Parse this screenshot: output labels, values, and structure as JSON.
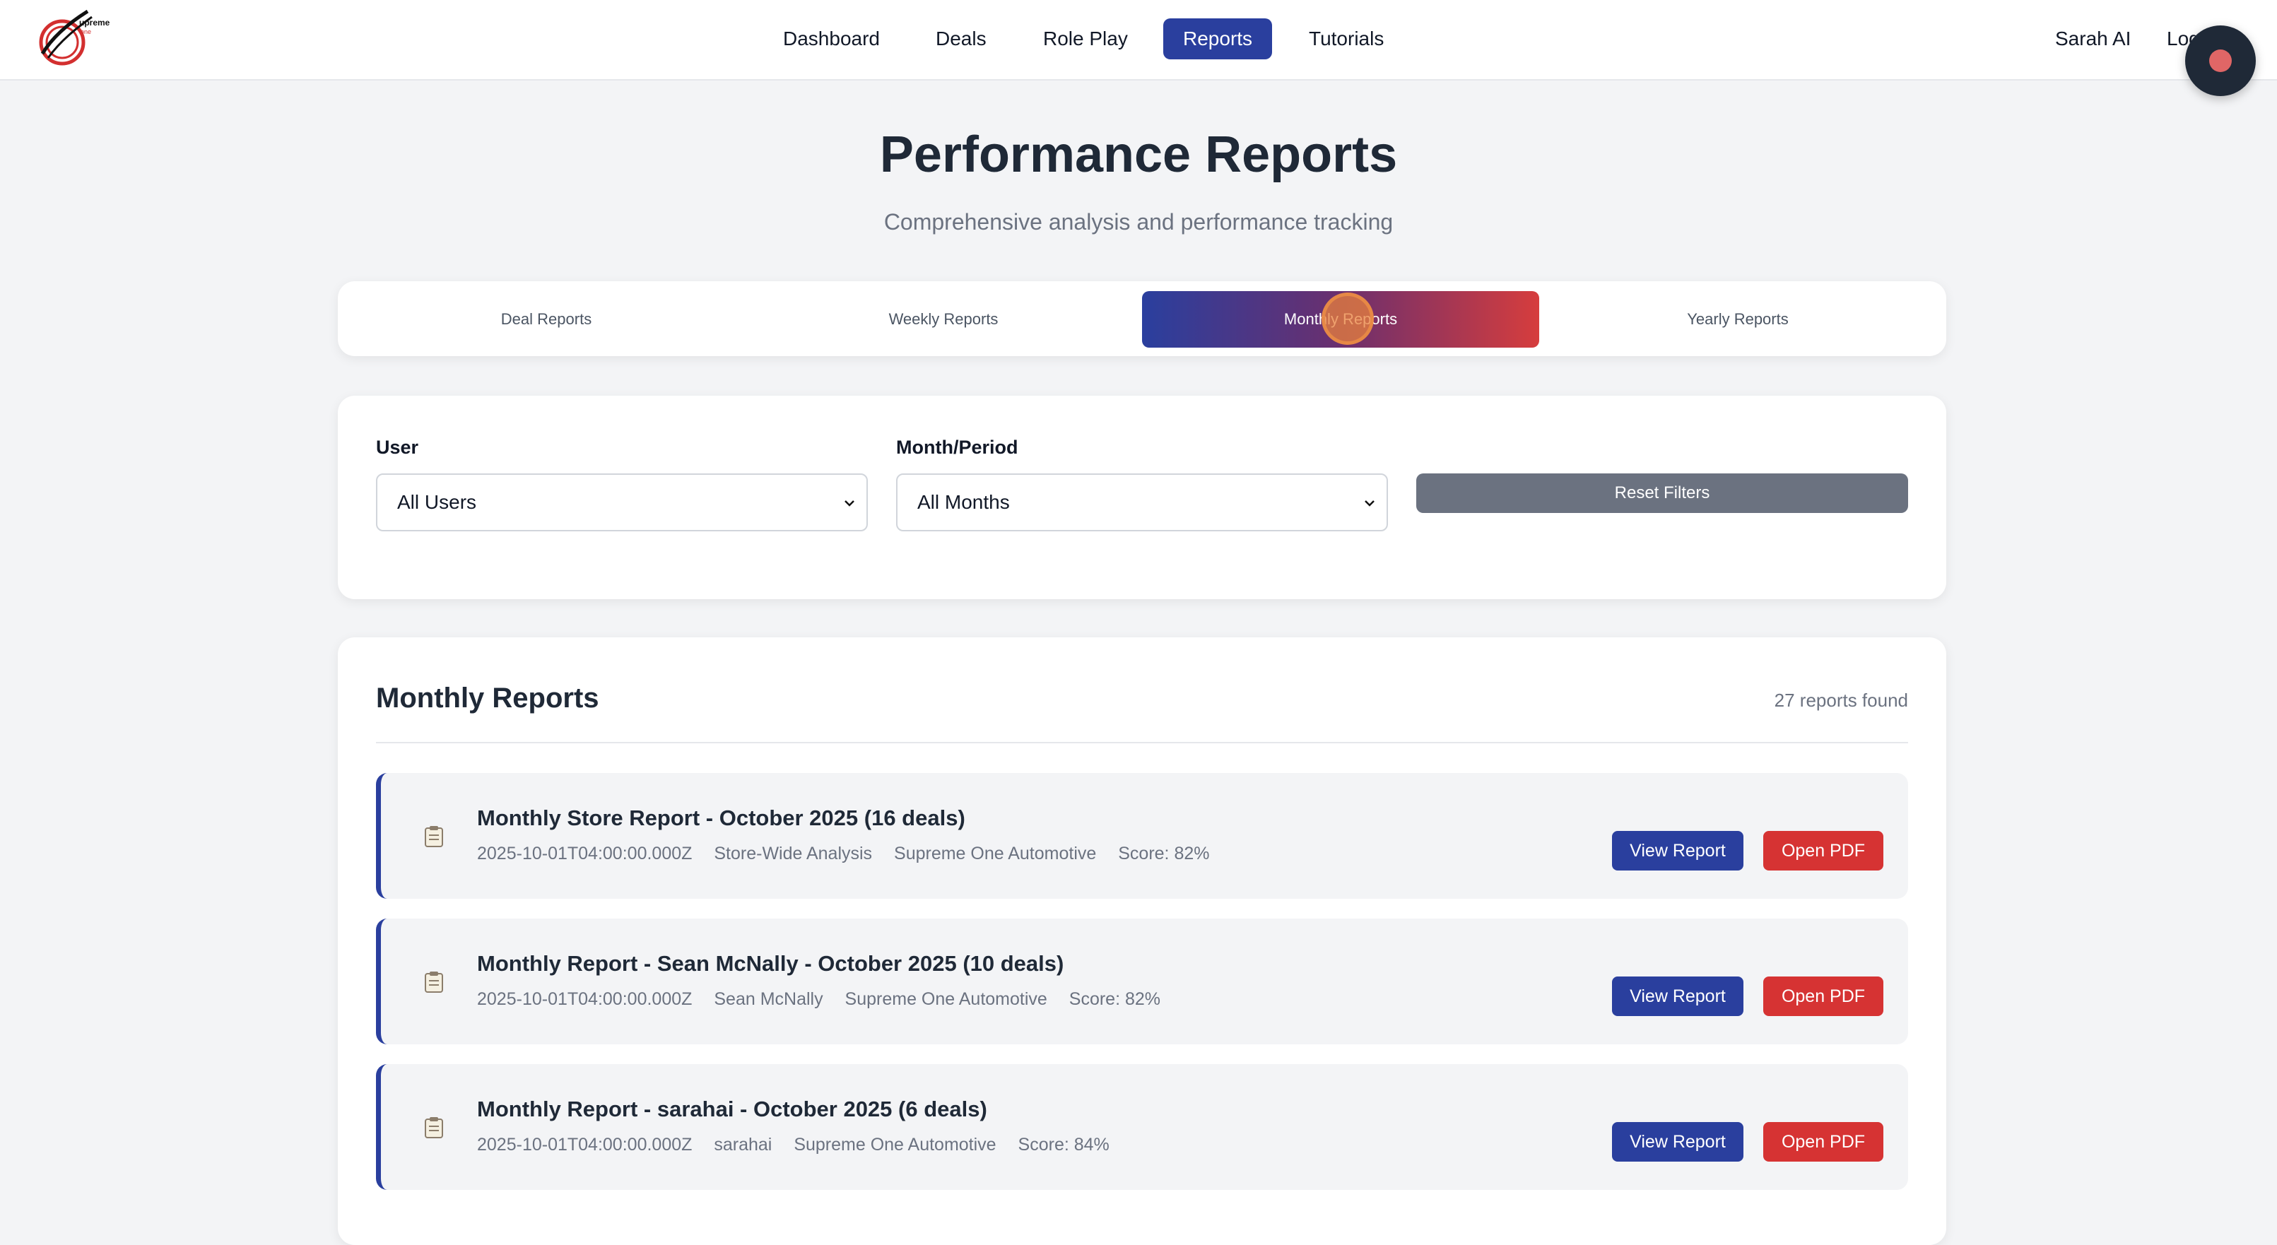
{
  "brand": {
    "logo_text": "Supreme One"
  },
  "nav": {
    "items": [
      "Dashboard",
      "Deals",
      "Role Play",
      "Reports",
      "Tutorials"
    ],
    "active": "Reports",
    "user_name": "Sarah AI",
    "logout_label": "Logout"
  },
  "header": {
    "title": "Performance Reports",
    "subtitle": "Comprehensive analysis and performance tracking"
  },
  "tabs": [
    "Deal Reports",
    "Weekly Reports",
    "Monthly Reports",
    "Yearly Reports"
  ],
  "active_tab": "Monthly Reports",
  "filters": {
    "user_label": "User",
    "user_value": "All Users",
    "period_label": "Month/Period",
    "period_value": "All Months",
    "reset_label": "Reset Filters"
  },
  "reports": {
    "title": "Monthly Reports",
    "count_text": "27 reports found",
    "view_label": "View Report",
    "pdf_label": "Open PDF",
    "items": [
      {
        "title": "Monthly Store Report - October 2025 (16 deals)",
        "date": "2025-10-01T04:00:00.000Z",
        "scope": "Store-Wide Analysis",
        "dealership": "Supreme One Automotive",
        "score": "Score: 82%"
      },
      {
        "title": "Monthly Report - Sean McNally - October 2025 (10 deals)",
        "date": "2025-10-01T04:00:00.000Z",
        "scope": "Sean McNally",
        "dealership": "Supreme One Automotive",
        "score": "Score: 82%"
      },
      {
        "title": "Monthly Report - sarahai - October 2025 (6 deals)",
        "date": "2025-10-01T04:00:00.000Z",
        "scope": "sarahai",
        "dealership": "Supreme One Automotive",
        "score": "Score: 84%"
      }
    ]
  },
  "colors": {
    "primary": "#2a3f9e",
    "danger": "#d63333",
    "muted": "#6b7280"
  }
}
